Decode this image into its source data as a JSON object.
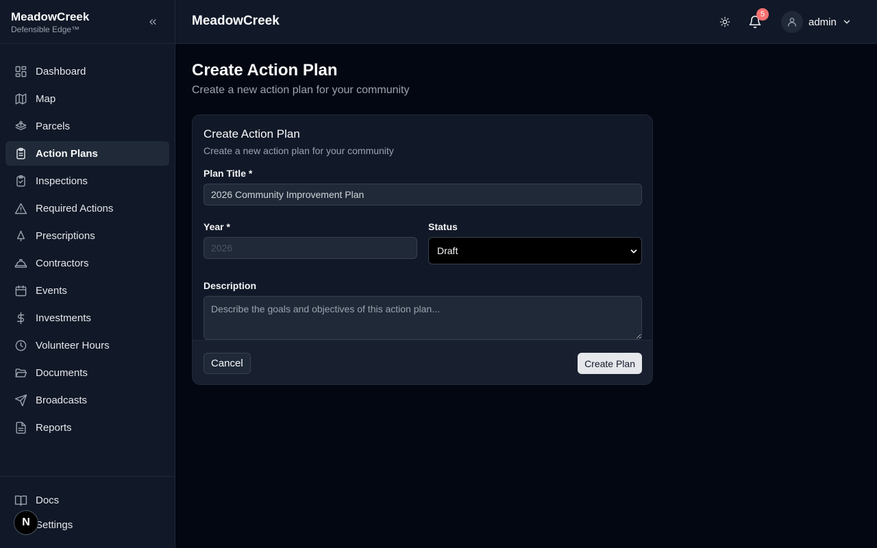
{
  "brand": {
    "name": "MeadowCreek",
    "tagline": "Defensible Edge™"
  },
  "sidebar": {
    "items": [
      {
        "label": "Dashboard",
        "icon": "dashboard-icon"
      },
      {
        "label": "Map",
        "icon": "map-icon"
      },
      {
        "label": "Parcels",
        "icon": "parcels-icon"
      },
      {
        "label": "Action Plans",
        "icon": "clipboard-list-icon",
        "active": true
      },
      {
        "label": "Inspections",
        "icon": "clipboard-check-icon"
      },
      {
        "label": "Required Actions",
        "icon": "warning-triangle-icon"
      },
      {
        "label": "Prescriptions",
        "icon": "tree-icon"
      },
      {
        "label": "Contractors",
        "icon": "hard-hat-icon"
      },
      {
        "label": "Events",
        "icon": "calendar-icon"
      },
      {
        "label": "Investments",
        "icon": "dollar-icon"
      },
      {
        "label": "Volunteer Hours",
        "icon": "clock-icon"
      },
      {
        "label": "Documents",
        "icon": "folder-open-icon"
      },
      {
        "label": "Broadcasts",
        "icon": "send-icon"
      },
      {
        "label": "Reports",
        "icon": "file-text-icon"
      }
    ],
    "bottom": [
      {
        "label": "Docs",
        "icon": "book-icon"
      },
      {
        "label": "Settings",
        "icon": "settings-icon"
      }
    ],
    "floating_badge": "N"
  },
  "header": {
    "title": "MeadowCreek",
    "notification_count": "5",
    "user": "admin"
  },
  "page": {
    "title": "Create Action Plan",
    "subtitle": "Create a new action plan for your community"
  },
  "form": {
    "card_title": "Create Action Plan",
    "card_subtitle": "Create a new action plan for your community",
    "plan_title_label": "Plan Title *",
    "plan_title_value": "2026 Community Improvement Plan",
    "year_label": "Year *",
    "year_placeholder": "2026",
    "status_label": "Status",
    "status_value": "Draft",
    "description_label": "Description",
    "description_placeholder": "Describe the goals and objectives of this action plan...",
    "cancel_label": "Cancel",
    "submit_label": "Create Plan"
  },
  "colors": {
    "background": "#030712",
    "surface": "#111827",
    "border": "#1f2937",
    "notification_badge": "#f87171"
  }
}
